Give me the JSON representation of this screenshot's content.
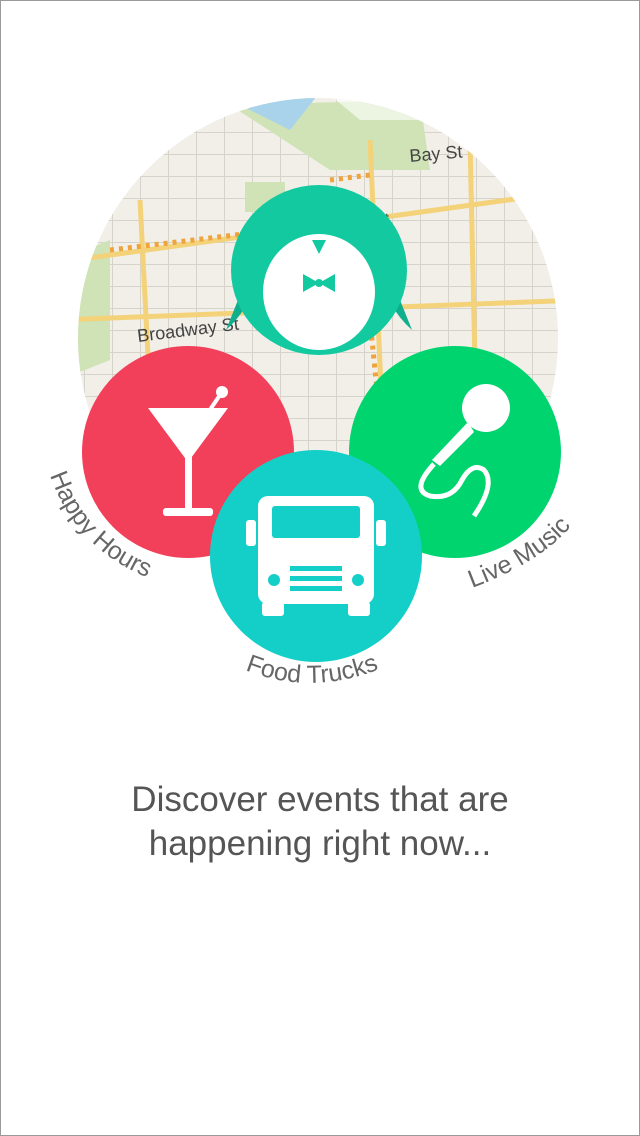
{
  "map": {
    "street_labels": [
      "Broadway St",
      "Bay St",
      "St"
    ]
  },
  "categories": [
    {
      "label": "Happy Hours",
      "icon": "cocktail-glass-icon",
      "color": "#f2405a"
    },
    {
      "label": "Food Trucks",
      "icon": "food-truck-icon",
      "color": "#13cfc8"
    },
    {
      "label": "Live Music",
      "icon": "microphone-icon",
      "color": "#00d46e"
    }
  ],
  "mascot": {
    "icon": "penguin-mascot-icon",
    "color": "#12c9a0"
  },
  "tagline": {
    "line1": "Discover events that are",
    "line2": "happening right now..."
  }
}
